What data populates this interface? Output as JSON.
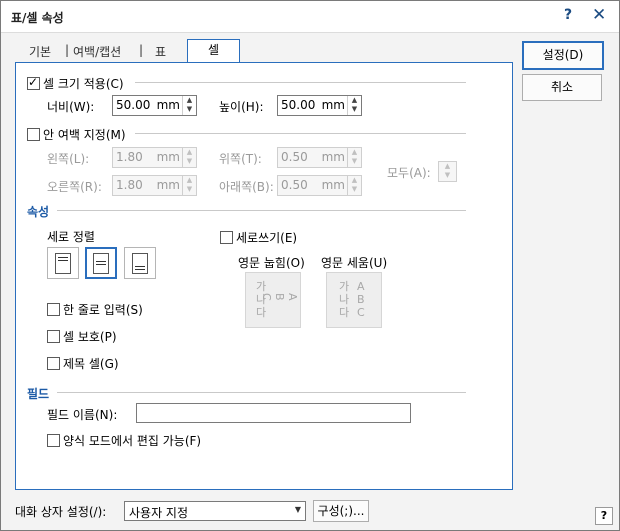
{
  "window": {
    "title": "표/셀 속성",
    "help_glyph": "?",
    "close_glyph": "✕"
  },
  "tabs": [
    {
      "label": "기본",
      "active": false
    },
    {
      "label": "여백/캡션",
      "active": false
    },
    {
      "label": "표",
      "active": false
    },
    {
      "label": "셀",
      "active": true
    }
  ],
  "tab_sep": "|",
  "buttons": {
    "ok": "설정(D)",
    "cancel": "취소",
    "config": "구성(;)..."
  },
  "cell_size": {
    "label": "셀 크기 적용(C)",
    "checked": true,
    "width_label": "너비(W):",
    "width_value": "50.00",
    "width_unit": "mm",
    "height_label": "높이(H):",
    "height_value": "50.00",
    "height_unit": "mm"
  },
  "inner_margin": {
    "label": "안 여백 지정(M)",
    "checked": false,
    "left_label": "왼쪽(L):",
    "left_value": "1.80",
    "left_unit": "mm",
    "top_label": "위쪽(T):",
    "top_value": "0.50",
    "top_unit": "mm",
    "right_label": "오른쪽(R):",
    "right_value": "1.80",
    "right_unit": "mm",
    "bottom_label": "아래쪽(B):",
    "bottom_value": "0.50",
    "bottom_unit": "mm",
    "all_label": "모두(A):"
  },
  "properties": {
    "group_title": "속성",
    "vertical_align_label": "세로 정렬",
    "vertical_writing_label": "세로쓰기(E)",
    "latin_lay_label": "영문 눕힘(O)",
    "latin_stand_label": "영문 세움(U)",
    "preview_hangul": "가나다",
    "preview_latin": "ABC",
    "single_line_label": "한 줄로 입력(S)",
    "cell_protect_label": "셀 보호(P)",
    "header_cell_label": "제목 셀(G)"
  },
  "field": {
    "group_title": "필드",
    "name_label": "필드 이름(N):",
    "name_value": "",
    "editable_label": "양식 모드에서 편집 가능(F)"
  },
  "footer": {
    "dialog_settings_label": "대화 상자 설정(/):",
    "dialog_settings_value": "사용자 지정",
    "help_glyph": "?"
  }
}
